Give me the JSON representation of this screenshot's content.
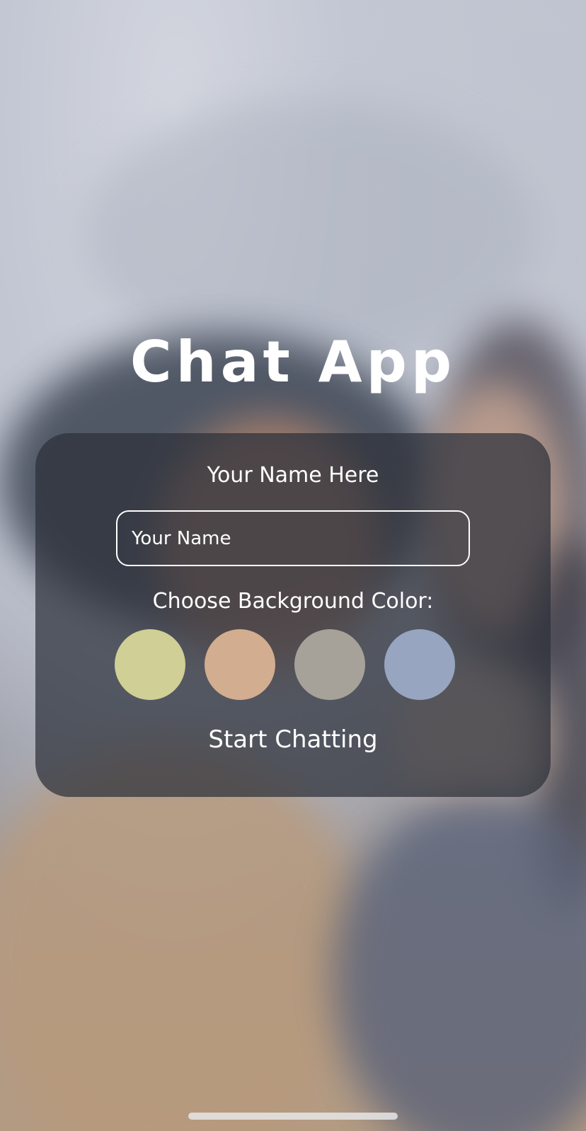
{
  "app": {
    "title": "Chat App"
  },
  "form": {
    "name_label": "Your Name Here",
    "name_input": {
      "placeholder": "Your Name",
      "value": ""
    },
    "color_label": "Choose Background Color:",
    "colors": [
      {
        "name": "yellow-green",
        "hex": "#d0cf95"
      },
      {
        "name": "peach",
        "hex": "#d2ad8f"
      },
      {
        "name": "gray",
        "hex": "#a7a299"
      },
      {
        "name": "blue-gray",
        "hex": "#97a5c0"
      }
    ],
    "start_label": "Start Chatting"
  },
  "theme": {
    "panel_color": "#2c303a",
    "text_color": "#ffffff"
  }
}
